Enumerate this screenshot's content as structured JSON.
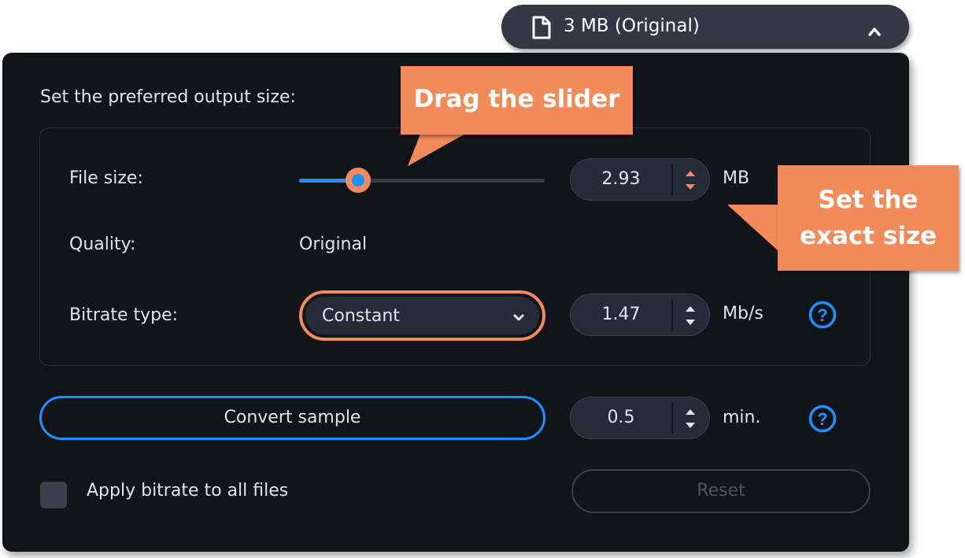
{
  "size_pill": {
    "label": "3 MB (Original)",
    "file_icon": "file-icon",
    "toggle_icon": "chevron-up-icon"
  },
  "panel": {
    "title": "Set the preferred output size:",
    "file_size": {
      "label": "File size:",
      "slider_fraction": 0.24,
      "value": "2.93",
      "unit": "MB"
    },
    "quality": {
      "label": "Quality:",
      "value": "Original"
    },
    "bitrate": {
      "label": "Bitrate type:",
      "selected": "Constant",
      "value": "1.47",
      "unit": "Mb/s",
      "help_icon": "help-icon"
    },
    "sample": {
      "button_label": "Convert sample",
      "value": "0.5",
      "unit": "min.",
      "help_icon": "help-icon"
    },
    "apply_all": {
      "label": "Apply bitrate to all files",
      "checked": false
    },
    "reset_label": "Reset"
  },
  "callouts": {
    "drag": "Drag the slider",
    "exact_line1": "Set the",
    "exact_line2": "exact size"
  },
  "colors": {
    "panel_bg": "#111419",
    "accent_blue": "#1e90ff",
    "callout_orange": "#f28a5a",
    "pill_bg": "#323945"
  }
}
